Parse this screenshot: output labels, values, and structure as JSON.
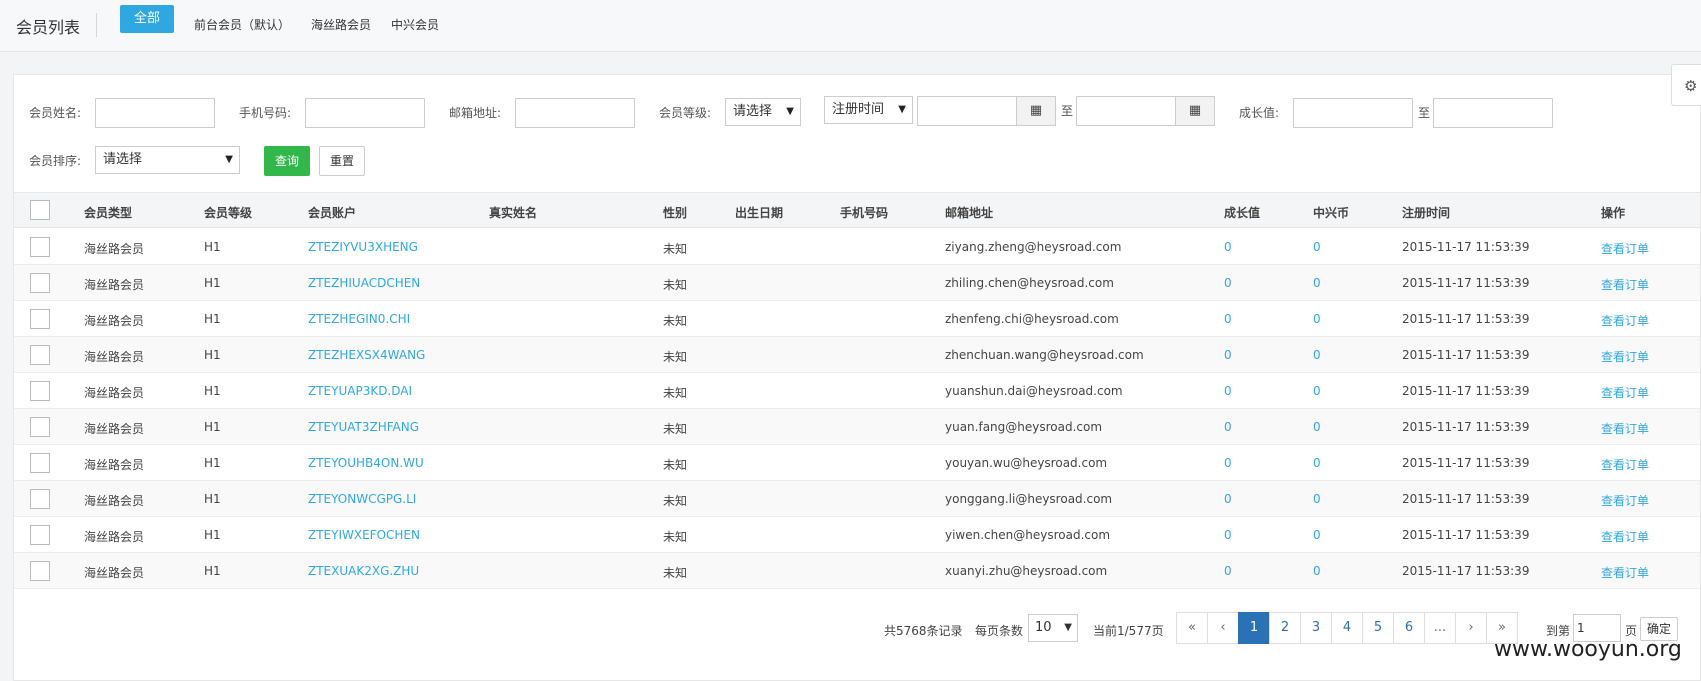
{
  "header": {
    "title": "会员列表",
    "tabs": [
      {
        "label": "全部",
        "active": true
      },
      {
        "label": "前台会员（默认）",
        "active": false
      },
      {
        "label": "海丝路会员",
        "active": false
      },
      {
        "label": "中兴会员",
        "active": false
      }
    ]
  },
  "settings_icon": "gear-icon",
  "filters": {
    "name_label": "会员姓名:",
    "phone_label": "手机号码:",
    "email_label": "邮箱地址:",
    "level_label": "会员等级:",
    "level_value": "请选择",
    "time_type_value": "注册时间",
    "to_label": "至",
    "growth_label": "成长值:",
    "growth_to_label": "至",
    "sort_label": "会员排序:",
    "sort_value": "请选择",
    "query_label": "查询",
    "reset_label": "重置",
    "calendar_icon": "calendar-icon"
  },
  "table": {
    "columns": [
      "会员类型",
      "会员等级",
      "会员账户",
      "真实姓名",
      "性别",
      "出生日期",
      "手机号码",
      "邮箱地址",
      "成长值",
      "中兴币",
      "注册时间",
      "操作"
    ],
    "rows": [
      {
        "type": "海丝路会员",
        "level": "H1",
        "account": "ZTEZIYVU3XHENG",
        "real_name": "",
        "gender": "未知",
        "birth": "",
        "phone": "",
        "email": "ziyang.zheng@heysroad.com",
        "growth": "0",
        "coins": "0",
        "reg_time": "2015-11-17 11:53:39",
        "action": "查看订单"
      },
      {
        "type": "海丝路会员",
        "level": "H1",
        "account": "ZTEZHIUACDCHEN",
        "real_name": "",
        "gender": "未知",
        "birth": "",
        "phone": "",
        "email": "zhiling.chen@heysroad.com",
        "growth": "0",
        "coins": "0",
        "reg_time": "2015-11-17 11:53:39",
        "action": "查看订单"
      },
      {
        "type": "海丝路会员",
        "level": "H1",
        "account": "ZTEZHEGIN0.CHI",
        "real_name": "",
        "gender": "未知",
        "birth": "",
        "phone": "",
        "email": "zhenfeng.chi@heysroad.com",
        "growth": "0",
        "coins": "0",
        "reg_time": "2015-11-17 11:53:39",
        "action": "查看订单"
      },
      {
        "type": "海丝路会员",
        "level": "H1",
        "account": "ZTEZHEXSX4WANG",
        "real_name": "",
        "gender": "未知",
        "birth": "",
        "phone": "",
        "email": "zhenchuan.wang@heysroad.com",
        "growth": "0",
        "coins": "0",
        "reg_time": "2015-11-17 11:53:39",
        "action": "查看订单"
      },
      {
        "type": "海丝路会员",
        "level": "H1",
        "account": "ZTEYUAP3KD.DAI",
        "real_name": "",
        "gender": "未知",
        "birth": "",
        "phone": "",
        "email": "yuanshun.dai@heysroad.com",
        "growth": "0",
        "coins": "0",
        "reg_time": "2015-11-17 11:53:39",
        "action": "查看订单"
      },
      {
        "type": "海丝路会员",
        "level": "H1",
        "account": "ZTEYUAT3ZHFANG",
        "real_name": "",
        "gender": "未知",
        "birth": "",
        "phone": "",
        "email": "yuan.fang@heysroad.com",
        "growth": "0",
        "coins": "0",
        "reg_time": "2015-11-17 11:53:39",
        "action": "查看订单"
      },
      {
        "type": "海丝路会员",
        "level": "H1",
        "account": "ZTEYOUHB4ON.WU",
        "real_name": "",
        "gender": "未知",
        "birth": "",
        "phone": "",
        "email": "youyan.wu@heysroad.com",
        "growth": "0",
        "coins": "0",
        "reg_time": "2015-11-17 11:53:39",
        "action": "查看订单"
      },
      {
        "type": "海丝路会员",
        "level": "H1",
        "account": "ZTEYONWCGPG.LI",
        "real_name": "",
        "gender": "未知",
        "birth": "",
        "phone": "",
        "email": "yonggang.li@heysroad.com",
        "growth": "0",
        "coins": "0",
        "reg_time": "2015-11-17 11:53:39",
        "action": "查看订单"
      },
      {
        "type": "海丝路会员",
        "level": "H1",
        "account": "ZTEYIWXEFOCHEN",
        "real_name": "",
        "gender": "未知",
        "birth": "",
        "phone": "",
        "email": "yiwen.chen@heysroad.com",
        "growth": "0",
        "coins": "0",
        "reg_time": "2015-11-17 11:53:39",
        "action": "查看订单"
      },
      {
        "type": "海丝路会员",
        "level": "H1",
        "account": "ZTEXUAK2XG.ZHU",
        "real_name": "",
        "gender": "未知",
        "birth": "",
        "phone": "",
        "email": "xuanyi.zhu@heysroad.com",
        "growth": "0",
        "coins": "0",
        "reg_time": "2015-11-17 11:53:39",
        "action": "查看订单"
      }
    ]
  },
  "pagination": {
    "total_text": "共5768条记录",
    "per_page_label": "每页条数",
    "per_page_value": "10",
    "current_text": "当前1/577页",
    "pages": [
      "«",
      "‹",
      "1",
      "2",
      "3",
      "4",
      "5",
      "6",
      "...",
      "›",
      "»"
    ],
    "active_page": "1",
    "goto_label": "到第",
    "goto_value": "1",
    "page_suffix": "页",
    "confirm_label": "确定"
  },
  "watermark": "www.wooyun.org"
}
